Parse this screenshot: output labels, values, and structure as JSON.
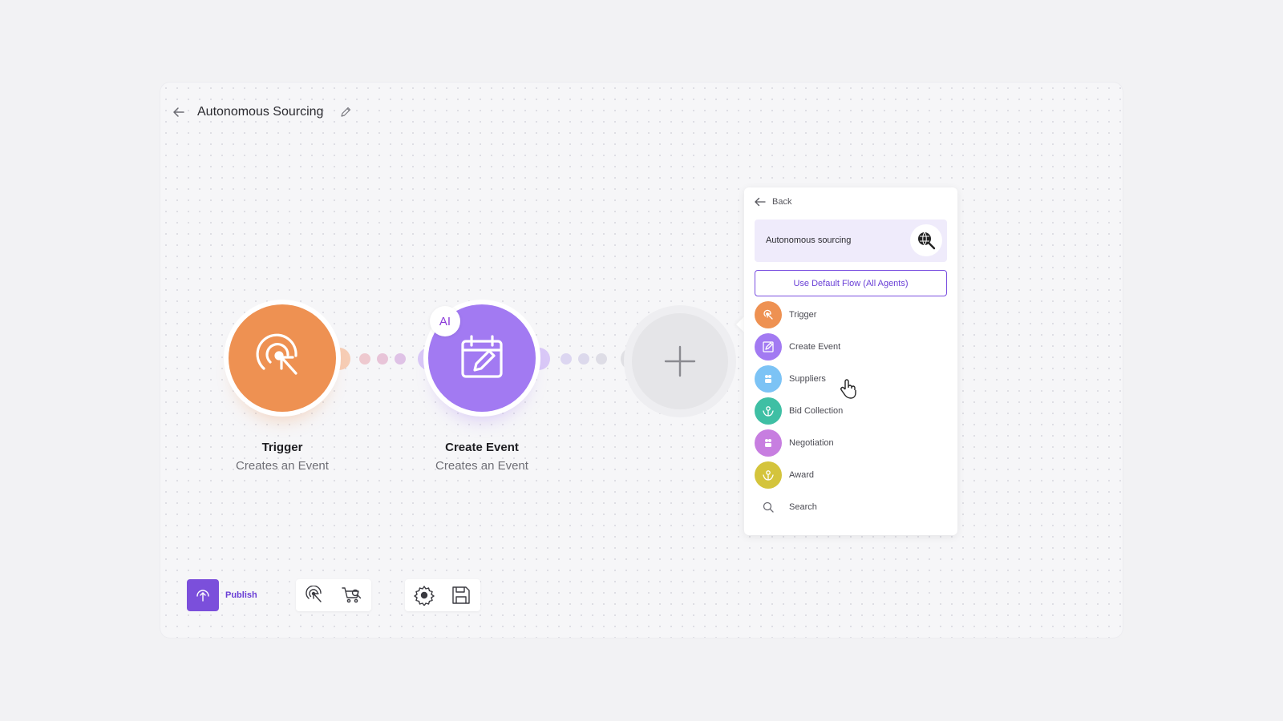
{
  "header": {
    "title": "Autonomous Sourcing",
    "back_icon": "back-arrow-icon",
    "edit_icon": "pencil-icon"
  },
  "nodes": [
    {
      "name": "Trigger",
      "subtitle": "Creates an Event",
      "color": "#ee9152",
      "icon": "trigger-cursor-icon"
    },
    {
      "name": "Create Event",
      "subtitle": "Creates an Event",
      "color": "#a27af2",
      "icon": "calendar-edit-icon",
      "badge": "AI"
    }
  ],
  "add_node": {
    "icon": "plus-icon"
  },
  "panel": {
    "back_label": "Back",
    "flow_card": {
      "label": "Autonomous sourcing",
      "icon": "globe-search-icon"
    },
    "default_button": "Use Default Flow (All Agents)",
    "items": [
      {
        "label": "Trigger",
        "color": "#ee9152",
        "icon": "trigger-cursor-icon"
      },
      {
        "label": "Create Event",
        "color": "#a27af2",
        "icon": "edit-square-icon"
      },
      {
        "label": "Suppliers",
        "color": "#7cc3f5",
        "icon": "supplier-icon"
      },
      {
        "label": "Bid Collection",
        "color": "#3fbfa4",
        "icon": "bid-hand-icon"
      },
      {
        "label": "Negotiation",
        "color": "#c77ee0",
        "icon": "negotiation-icon"
      },
      {
        "label": "Award",
        "color": "#d4c43c",
        "icon": "award-hand-icon"
      },
      {
        "label": "Search",
        "color": "",
        "icon": "search-icon"
      }
    ]
  },
  "toolbar": {
    "publish_label": "Publish",
    "publish_color": "#7b4fdb",
    "tools": [
      "trigger-cursor-icon",
      "cart-search-icon",
      "settings-gear-icon",
      "save-floppy-icon"
    ]
  }
}
